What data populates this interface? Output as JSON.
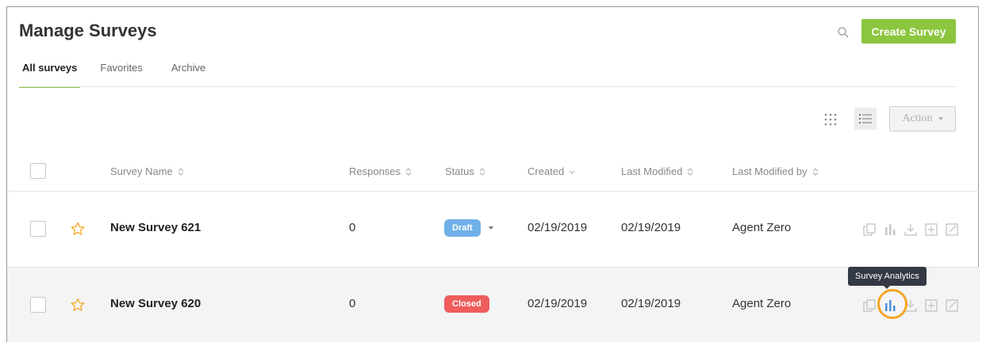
{
  "header": {
    "title": "Manage Surveys",
    "create_label": "Create Survey",
    "search_icon": "search-icon"
  },
  "tabs": [
    {
      "label": "All surveys",
      "active": true
    },
    {
      "label": "Favorites",
      "active": false
    },
    {
      "label": "Archive",
      "active": false
    }
  ],
  "toolbar": {
    "action_label": "Action",
    "view_icons": [
      "grid-view-icon",
      "list-view-icon"
    ]
  },
  "table": {
    "columns": [
      "Survey Name",
      "Responses",
      "Status",
      "Created",
      "Last Modified",
      "Last Modified by"
    ],
    "rows": [
      {
        "name": "New Survey 621",
        "responses": "0",
        "status": "Draft",
        "created": "02/19/2019",
        "modified": "02/19/2019",
        "modified_by": "Agent Zero"
      },
      {
        "name": "New Survey 620",
        "responses": "0",
        "status": "Closed",
        "created": "02/19/2019",
        "modified": "02/19/2019",
        "modified_by": "Agent Zero"
      }
    ],
    "row_actions": [
      "copy-icon",
      "analytics-icon",
      "download-icon",
      "add-icon",
      "open-external-icon"
    ]
  },
  "tooltip": {
    "text": "Survey Analytics"
  },
  "colors": {
    "accent_green": "#8cc63f",
    "draft_blue": "#6fb0e8",
    "closed_red": "#ef5d5d",
    "star_orange": "#f5a623",
    "analytics_active": "#4a90d9"
  }
}
